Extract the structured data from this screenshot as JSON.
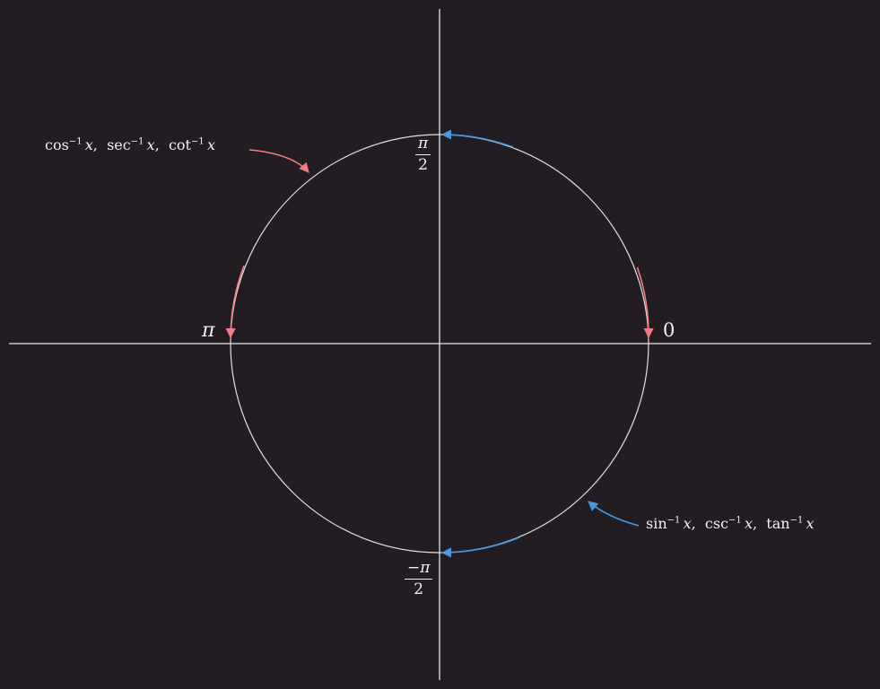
{
  "angles": {
    "zero": "0",
    "pi": "π",
    "pi_half_num": "π",
    "pi_half_den": "2",
    "neg_pi_half_num": "−π",
    "neg_pi_half_den": "2"
  },
  "functions": {
    "cos_group": {
      "f1": "cos",
      "f2": "sec",
      "f3": "cot",
      "exp": "−1",
      "var": "x"
    },
    "sin_group": {
      "f1": "sin",
      "f2": "csc",
      "f3": "tan",
      "exp": "−1",
      "var": "x"
    }
  },
  "colors": {
    "background": "#211d22",
    "axes": "#e8e8e8",
    "circle": "#e0e0e0",
    "cos_range": "#f37c7f",
    "sin_range": "#4b98e0"
  }
}
